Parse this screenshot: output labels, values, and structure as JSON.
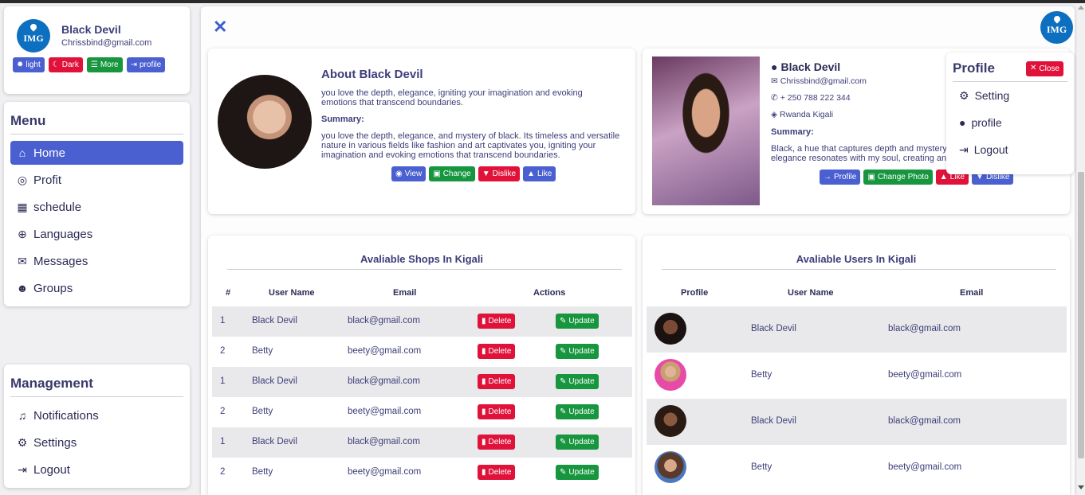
{
  "user": {
    "name": "Black Devil",
    "email": "Chrissbind@gmail.com",
    "logo_text": "IMG"
  },
  "theme_buttons": [
    {
      "label": "light",
      "icon": "sun-icon"
    },
    {
      "label": "Dark",
      "icon": "moon-icon"
    },
    {
      "label": "More",
      "icon": "menu-icon"
    },
    {
      "label": "profile",
      "icon": "sign-out-icon"
    }
  ],
  "menu": {
    "title": "Menu",
    "items": [
      {
        "label": "Home",
        "icon": "home-icon"
      },
      {
        "label": "Profit",
        "icon": "coins-icon"
      },
      {
        "label": "schedule",
        "icon": "calendar-icon"
      },
      {
        "label": "Languages",
        "icon": "globe-icon"
      },
      {
        "label": "Messages",
        "icon": "comments-icon"
      },
      {
        "label": "Groups",
        "icon": "users-icon"
      }
    ]
  },
  "management": {
    "title": "Management",
    "items": [
      {
        "label": "Notifications",
        "icon": "bell-icon"
      },
      {
        "label": "Settings",
        "icon": "gear-icon"
      },
      {
        "label": "Logout",
        "icon": "sign-out-icon"
      }
    ]
  },
  "header": {
    "close_glyph": "✕",
    "logo_text": "IMG"
  },
  "about": {
    "title": "About Black Devil",
    "text": "you love the depth, elegance, igniting your imagination and evoking emotions that transcend boundaries.",
    "summary_label": "Summary:",
    "summary": "you love the depth, elegance, and mystery of black. Its timeless and versatile nature in various fields like fashion and art captivates you, igniting your imagination and evoking emotions that transcend boundaries.",
    "buttons": [
      "View",
      "Change",
      "Dislike",
      "Like"
    ]
  },
  "profile_card": {
    "name": "Black Devil",
    "email": "Chrissbind@gmail.com",
    "phone": "+ 250 788 222 344",
    "location": "Rwanda Kigali",
    "summary_label": "Summary:",
    "summary": "Black, a hue that captures depth and mystery, elegance resonates with my soul, creating an",
    "buttons": [
      "Profile",
      "Change Photo",
      "Like",
      "Dislike"
    ]
  },
  "dropdown": {
    "title": "Profile",
    "close_label": "Close",
    "items": [
      {
        "label": "Setting",
        "icon": "gear-icon"
      },
      {
        "label": "profile",
        "icon": "user-icon"
      },
      {
        "label": "Logout",
        "icon": "sign-out-icon"
      }
    ]
  },
  "shops": {
    "title": "Avaliable Shops In Kigali",
    "columns": [
      "#",
      "User Name",
      "Email",
      "Actions"
    ],
    "delete_label": "Delete",
    "update_label": "Update",
    "rows": [
      {
        "num": "1",
        "name": "Black Devil",
        "email": "black@gmail.com"
      },
      {
        "num": "2",
        "name": "Betty",
        "email": "beety@gmail.com"
      },
      {
        "num": "1",
        "name": "Black Devil",
        "email": "black@gmail.com"
      },
      {
        "num": "2",
        "name": "Betty",
        "email": "beety@gmail.com"
      },
      {
        "num": "1",
        "name": "Black Devil",
        "email": "black@gmail.com"
      },
      {
        "num": "2",
        "name": "Betty",
        "email": "beety@gmail.com"
      }
    ]
  },
  "users": {
    "title": "Avaliable Users In Kigali",
    "columns": [
      "Profile",
      "User Name",
      "Email"
    ],
    "rows": [
      {
        "name": "Black Devil",
        "email": "black@gmail.com"
      },
      {
        "name": "Betty",
        "email": "beety@gmail.com"
      },
      {
        "name": "Black Devil",
        "email": "black@gmail.com"
      },
      {
        "name": "Betty",
        "email": "beety@gmail.com"
      }
    ]
  }
}
